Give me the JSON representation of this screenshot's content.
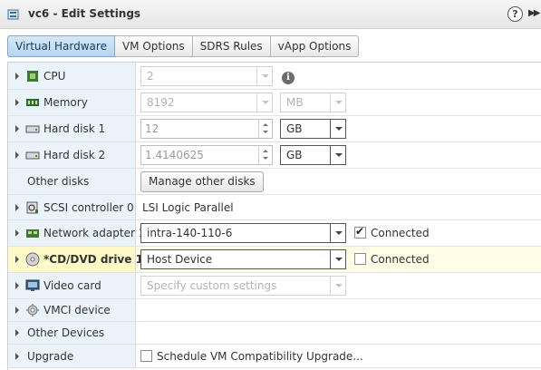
{
  "window": {
    "title": "vc6 - Edit Settings",
    "help_glyph": "?",
    "expand_glyph": "▶▶"
  },
  "tabs": [
    {
      "label": "Virtual Hardware",
      "active": true
    },
    {
      "label": "VM Options",
      "active": false
    },
    {
      "label": "SDRS Rules",
      "active": false
    },
    {
      "label": "vApp Options",
      "active": false
    }
  ],
  "hardware": {
    "cpu": {
      "label": "CPU",
      "value": "2",
      "info_glyph": "i",
      "icon": "cpu-icon"
    },
    "memory": {
      "label": "Memory",
      "value": "8192",
      "unit": "MB",
      "icon": "memory-icon"
    },
    "hard_disk_1": {
      "label": "Hard disk 1",
      "value": "12",
      "unit": "GB",
      "icon": "hard-disk-icon"
    },
    "hard_disk_2": {
      "label": "Hard disk 2",
      "value": "1.4140625",
      "unit": "GB",
      "icon": "hard-disk-icon"
    },
    "other_disks": {
      "label": "Other disks",
      "button": "Manage other disks"
    },
    "scsi_controller": {
      "label": "SCSI controller 0",
      "value": "LSI Logic Parallel",
      "icon": "scsi-controller-icon"
    },
    "network_adapter": {
      "label": "Network adapter 1",
      "value": "intra-140-110-6",
      "connected_label": "Connected",
      "connected": true,
      "icon": "network-adapter-icon"
    },
    "cd_dvd": {
      "label": "*CD/DVD drive 1",
      "value": "Host Device",
      "connected_label": "Connected",
      "connected": false,
      "icon": "cd-dvd-icon"
    },
    "video_card": {
      "label": "Video card",
      "value": "Specify custom settings",
      "icon": "video-card-icon"
    },
    "vmci_device": {
      "label": "VMCI device",
      "icon": "vmci-device-icon"
    },
    "other_devices": {
      "label": "Other Devices"
    },
    "upgrade": {
      "label": "Upgrade",
      "checkbox_label": "Schedule VM Compatibility Upgrade...",
      "checked": false
    }
  },
  "colors": {
    "label_column_bg": "#eaf2fa",
    "selected_row_bg": "#fff9c8",
    "active_tab_bg": "#b7d5ef"
  }
}
